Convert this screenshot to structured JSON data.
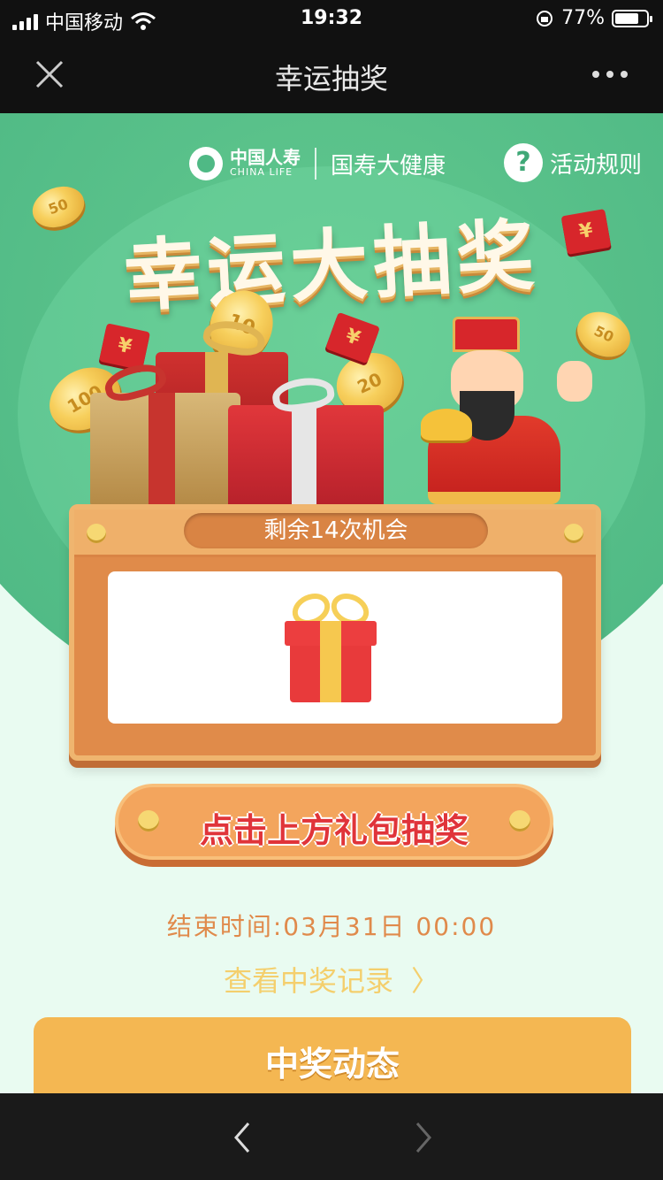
{
  "status_bar": {
    "carrier": "中国移动",
    "time": "19:32",
    "battery_percent": "77%",
    "battery_level": 0.77
  },
  "navbar": {
    "title": "幸运抽奖"
  },
  "brand": {
    "name_cn": "中国人寿",
    "name_en": "CHINA LIFE",
    "sub": "国寿大健康"
  },
  "rules": {
    "label": "活动规则"
  },
  "hero": {
    "title": "幸运大抽奖",
    "coins": [
      "50",
      "10",
      "100",
      "20",
      "50"
    ],
    "redpacket_symbol": "¥"
  },
  "board": {
    "chances_text": "剩余14次机会"
  },
  "draw_button": {
    "label": "点击上方礼包抽奖"
  },
  "end_time": "结束时间:03月31日  00:00",
  "records_link": {
    "label": "查看中奖记录",
    "chevron": "〉"
  },
  "dynamics": {
    "title": "中奖动态"
  },
  "colors": {
    "hero_green": "#4fb985",
    "page_bg": "#e9fbf1",
    "board_orange": "#e08b4a",
    "accent_red": "#e0343a",
    "gold": "#f4b752"
  }
}
